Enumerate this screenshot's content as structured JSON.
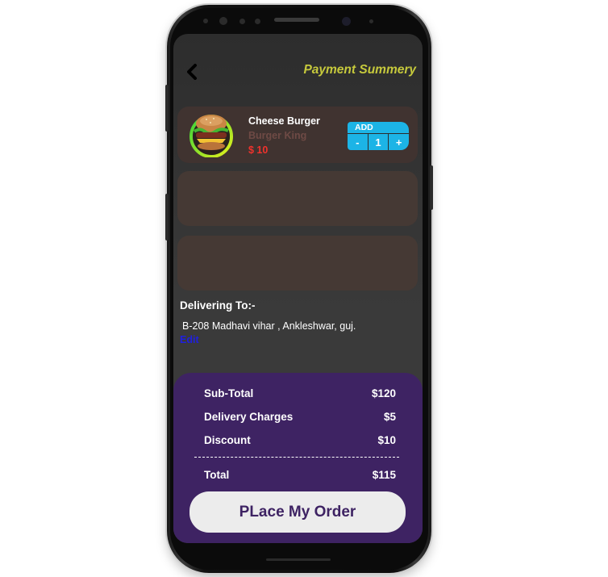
{
  "header": {
    "title": "Payment Summery",
    "back_icon": "chevron-left-icon"
  },
  "cart": {
    "items": [
      {
        "name": "Cheese Burger",
        "restaurant": "Burger King",
        "price": "$ 10",
        "image_icon": "burger-image",
        "add_label": "ADD",
        "minus_label": "-",
        "quantity": "1",
        "plus_label": "+"
      }
    ]
  },
  "delivery": {
    "label": "Delivering To:-",
    "address": "B-208 Madhavi vihar , Ankleshwar, guj.",
    "edit_label": "Edit"
  },
  "summary": {
    "subtotal_label": "Sub-Total",
    "subtotal_value": "$120",
    "delivery_label": "Delivery Charges",
    "delivery_value": "$5",
    "discount_label": "Discount",
    "discount_value": "$10",
    "total_label": "Total",
    "total_value": "$115",
    "order_button_label": "PLace My Order"
  },
  "colors": {
    "title": "#c6c93c",
    "qty_widget": "#1cb4e6",
    "price": "#f0322c",
    "restaurant": "#6e4a45",
    "edit_link": "#1f1fe0",
    "summary_panel": "#3e2363",
    "order_button": "#ececec"
  }
}
